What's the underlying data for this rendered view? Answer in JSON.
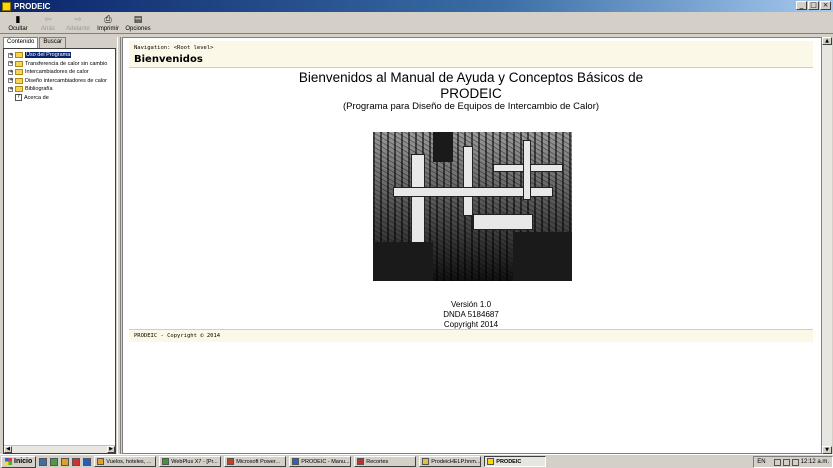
{
  "window": {
    "title": "PRODEIC",
    "minimize": "_",
    "restore": "□",
    "close": "×"
  },
  "toolbar": {
    "items": [
      {
        "label": "Ocultar",
        "icon": "hide-icon",
        "glyph": "▮",
        "enabled": true
      },
      {
        "label": "Atrás",
        "icon": "back-arrow-icon",
        "glyph": "⇦",
        "enabled": false
      },
      {
        "label": "Adelante",
        "icon": "forward-arrow-icon",
        "glyph": "⇨",
        "enabled": false
      },
      {
        "label": "Imprimir",
        "icon": "printer-icon",
        "glyph": "⎙",
        "enabled": true
      },
      {
        "label": "Opciones",
        "icon": "options-icon",
        "glyph": "▤",
        "enabled": true
      }
    ]
  },
  "sidebar": {
    "tabs": [
      "Contenido",
      "Buscar"
    ],
    "tree": [
      {
        "label": "Uso del Programa",
        "selected": true,
        "type": "folder"
      },
      {
        "label": "Transferencia de calor sin cambio",
        "type": "folder"
      },
      {
        "label": "Intercambiadores de calor",
        "type": "folder"
      },
      {
        "label": "Diseño intercambiadores de calor",
        "type": "folder"
      },
      {
        "label": "Bibliografía",
        "type": "folder"
      },
      {
        "label": "Acerca de",
        "type": "page"
      }
    ]
  },
  "content": {
    "navigation": "Navigation: <Root level>",
    "page_title": "Bienvenidos",
    "heading_line1": "Bienvenidos al Manual de Ayuda y Conceptos Básicos de",
    "heading_line2": "PRODEIC",
    "subheading": "(Programa para Diseño de Equipos de Intercambio de Calor)",
    "version": "Versión 1.0",
    "dnda": "DNDA 5184687",
    "copyright": "Copyright 2014",
    "footer": "PRODEIC - Copyright © 2014"
  },
  "taskbar": {
    "start": "Inicio",
    "tasks": [
      {
        "label": "Vuelos, hoteles, ...",
        "active": false
      },
      {
        "label": "WebPlus X7 - [Pr...",
        "active": false
      },
      {
        "label": "Microsoft Power...",
        "active": false
      },
      {
        "label": "PRODEIC - Manu...",
        "active": false
      },
      {
        "label": "Recortes",
        "active": false
      },
      {
        "label": "ProdeicHELP.hnm...",
        "active": false
      },
      {
        "label": "PRODEIC",
        "active": true
      }
    ],
    "language": "EN",
    "clock": "12:12 a.m."
  }
}
